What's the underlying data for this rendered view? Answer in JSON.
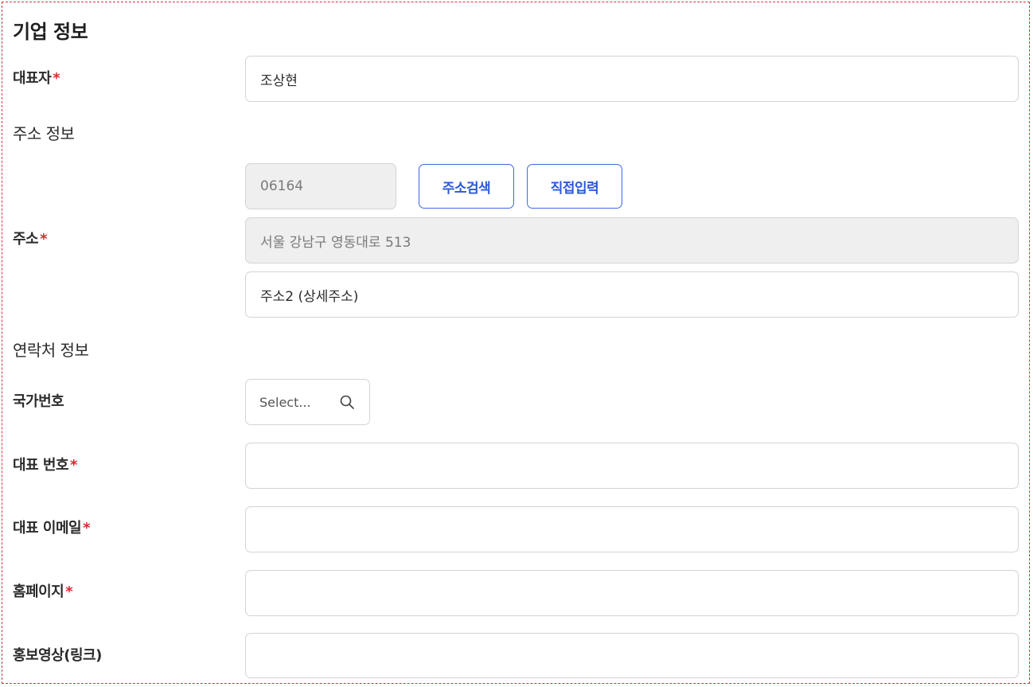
{
  "section_title": "기업 정보",
  "required_mark": "*",
  "representative": {
    "label": "대표자",
    "value": "조상현"
  },
  "address_group_title": "주소 정보",
  "address": {
    "label": "주소",
    "postal_code": "06164",
    "search_button": "주소검색",
    "manual_button": "직접입력",
    "address1": "서울 강남구 영동대로 513",
    "address2_placeholder": "주소2 (상세주소)"
  },
  "contact_group_title": "연락처 정보",
  "country_code": {
    "label": "국가번호",
    "placeholder": "Select..."
  },
  "main_phone": {
    "label": "대표 번호",
    "value": ""
  },
  "main_email": {
    "label": "대표 이메일",
    "value": ""
  },
  "homepage": {
    "label": "홈페이지",
    "value": ""
  },
  "promo_video": {
    "label": "홍보영상(링크)",
    "value": ""
  }
}
